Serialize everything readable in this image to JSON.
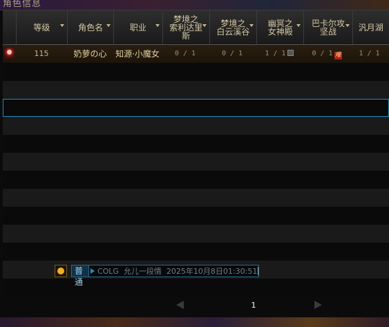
{
  "window": {
    "title": "角色信息"
  },
  "header": {
    "columns": [
      {
        "label": ""
      },
      {
        "label": "等级"
      },
      {
        "label": "角色名"
      },
      {
        "label": "职业"
      },
      {
        "label": "梦境之\n索利达里\n斯"
      },
      {
        "label": "梦境之\n白云溪谷"
      },
      {
        "label": "幽冥之\n女神殿"
      },
      {
        "label": "巴卡尔攻\n坚战"
      },
      {
        "label": "汎月湖"
      }
    ]
  },
  "rows": [
    {
      "level": "115",
      "name": "奶萝の心",
      "job": "知源·小魔女",
      "d1": "0 / 1",
      "d2": "0 / 1",
      "d3": "1 / 1",
      "d4": "0 / 1",
      "d5": "1 / 1",
      "hard_icon_text": "难"
    }
  ],
  "chat": {
    "channel": "普通",
    "text": "COLG  允儿一段情  2025年10月8日01:30:51"
  },
  "pager": {
    "page": "1"
  },
  "colors": {
    "accent": "#1a8fc0",
    "text": "#c8b88a",
    "active_row": "#2a1e10"
  }
}
